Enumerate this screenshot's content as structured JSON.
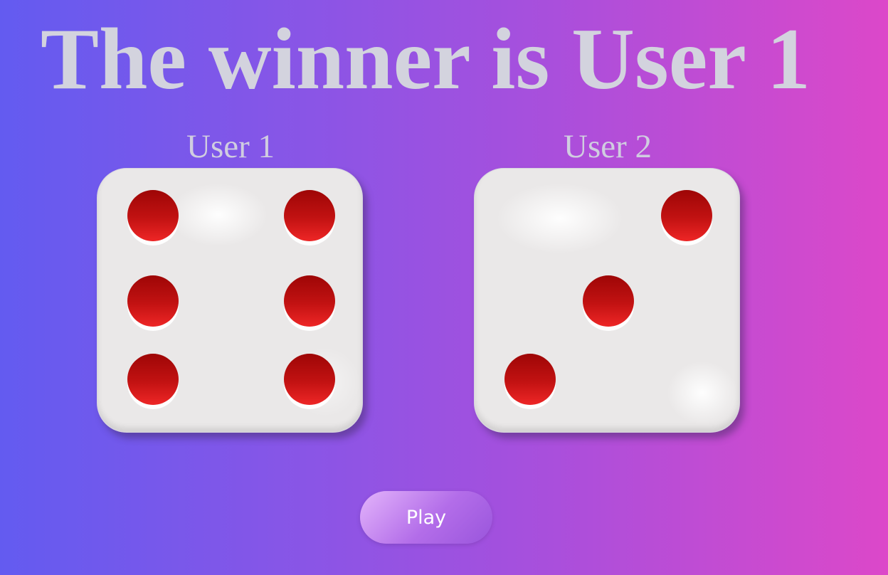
{
  "header": {
    "title": "The winner is User 1"
  },
  "players": [
    {
      "label": "User 1",
      "die_value": 6
    },
    {
      "label": "User 2",
      "die_value": 3
    }
  ],
  "controls": {
    "play_label": "Play"
  },
  "colors": {
    "title_text": "#d3d3de",
    "die_face": "#eae8e8",
    "pip": "#c21212",
    "background_start": "#635bf0",
    "background_end": "#dc48c9"
  }
}
